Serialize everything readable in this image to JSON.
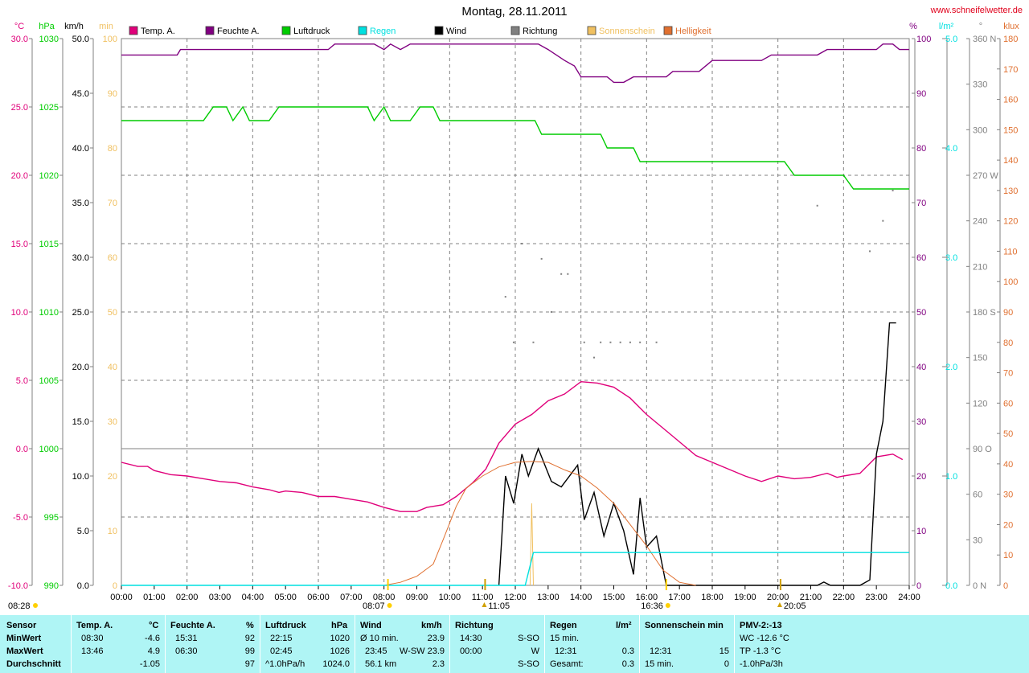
{
  "page": {
    "title": "Montag, 28.11.2011",
    "site": "www.schneifelwetter.de"
  },
  "colors": {
    "temp": "#e0007a",
    "humidity": "#800080",
    "pressure": "#00cc00",
    "rain": "#00e0e0",
    "wind": "#000000",
    "direction": "#808080",
    "sunshine": "#f0c060",
    "brightness": "#e07030",
    "table_bg": "#aff5f5"
  },
  "units": {
    "temp": "°C",
    "pressure": "hPa",
    "wind": "km/h",
    "sun": "min",
    "humidity": "%",
    "rain": "l/m²",
    "dir": "°",
    "lux": "klux"
  },
  "legend": [
    {
      "label": "Temp. A.",
      "color": "#e0007a"
    },
    {
      "label": "Feuchte A.",
      "color": "#800080"
    },
    {
      "label": "Luftdruck",
      "color": "#00cc00"
    },
    {
      "label": "Regen",
      "color": "#00e0e0"
    },
    {
      "label": "Wind",
      "color": "#000000"
    },
    {
      "label": "Richtung",
      "color": "#808080"
    },
    {
      "label": "Sonnenschein",
      "color": "#f0c060"
    },
    {
      "label": "Helligkeit",
      "color": "#e07030"
    }
  ],
  "chart_data": {
    "type": "line",
    "title": "Montag, 28.11.2011",
    "x_ticks": [
      "00:00",
      "01:00",
      "02:00",
      "03:00",
      "04:00",
      "05:00",
      "06:00",
      "07:00",
      "08:00",
      "09:00",
      "10:00",
      "11:00",
      "12:00",
      "13:00",
      "14:00",
      "15:00",
      "16:00",
      "17:00",
      "18:00",
      "19:00",
      "20:00",
      "21:00",
      "22:00",
      "23:00",
      "24:00"
    ],
    "axes": {
      "temp": {
        "ticks": [
          "30.0",
          "25.0",
          "20.0",
          "15.0",
          "10.0",
          "5.0",
          "0.0",
          "-5.0",
          "-10.0"
        ],
        "range": [
          -10,
          30
        ]
      },
      "pressure": {
        "ticks": [
          "1030",
          "1025",
          "1020",
          "1015",
          "1010",
          "1005",
          "1000",
          "995",
          "990"
        ],
        "range": [
          990,
          1030
        ]
      },
      "wind": {
        "ticks": [
          "50.0",
          "45.0",
          "40.0",
          "35.0",
          "30.0",
          "25.0",
          "20.0",
          "15.0",
          "10.0",
          "5.0",
          "0.0"
        ],
        "range": [
          0,
          50
        ]
      },
      "sun": {
        "ticks": [
          "100",
          "90",
          "80",
          "70",
          "60",
          "50",
          "40",
          "30",
          "20",
          "10",
          "0"
        ],
        "range": [
          0,
          100
        ]
      },
      "humidity": {
        "ticks": [
          "100",
          "90",
          "80",
          "70",
          "60",
          "50",
          "40",
          "30",
          "20",
          "10",
          "0"
        ],
        "range": [
          0,
          100
        ]
      },
      "rain": {
        "ticks": [
          "5.0",
          "4.0",
          "3.0",
          "2.0",
          "1.0",
          "0.0"
        ],
        "range": [
          0,
          5
        ]
      },
      "direction": {
        "ticks": [
          "360 N",
          "330",
          "300",
          "270 W",
          "240",
          "210",
          "180 S",
          "150",
          "120",
          "90 O",
          "60",
          "30",
          "0 N"
        ],
        "range": [
          0,
          360
        ]
      },
      "lux": {
        "ticks": [
          "180",
          "170",
          "160",
          "150",
          "140",
          "130",
          "120",
          "110",
          "100",
          "90",
          "80",
          "70",
          "60",
          "50",
          "40",
          "30",
          "20",
          "10",
          "0"
        ],
        "range": [
          0,
          180
        ]
      }
    },
    "events": [
      {
        "label": "08:28",
        "hour": 8.47,
        "kind": "temp-min"
      },
      {
        "label": "08:07",
        "hour": 8.12,
        "kind": "sunrise"
      },
      {
        "label": "11:05",
        "hour": 11.08,
        "kind": "moonrise"
      },
      {
        "label": "16:36",
        "hour": 16.6,
        "kind": "sunset"
      },
      {
        "label": "20:05",
        "hour": 20.08,
        "kind": "moonset"
      }
    ],
    "series": [
      {
        "name": "Temp. A.",
        "axis": "temp",
        "points": [
          [
            0,
            -1.0
          ],
          [
            0.5,
            -1.3
          ],
          [
            0.8,
            -1.3
          ],
          [
            1,
            -1.6
          ],
          [
            1.5,
            -1.9
          ],
          [
            2,
            -2.0
          ],
          [
            2.5,
            -2.2
          ],
          [
            3,
            -2.4
          ],
          [
            3.5,
            -2.5
          ],
          [
            4,
            -2.8
          ],
          [
            4.5,
            -3.0
          ],
          [
            4.8,
            -3.2
          ],
          [
            5,
            -3.1
          ],
          [
            5.5,
            -3.2
          ],
          [
            6,
            -3.5
          ],
          [
            6.5,
            -3.5
          ],
          [
            7,
            -3.7
          ],
          [
            7.5,
            -3.9
          ],
          [
            8,
            -4.3
          ],
          [
            8.5,
            -4.6
          ],
          [
            9,
            -4.6
          ],
          [
            9.3,
            -4.3
          ],
          [
            9.8,
            -4.1
          ],
          [
            10.2,
            -3.5
          ],
          [
            10.7,
            -2.5
          ],
          [
            11.1,
            -1.5
          ],
          [
            11.5,
            0.4
          ],
          [
            12,
            1.8
          ],
          [
            12.5,
            2.5
          ],
          [
            12.8,
            3.1
          ],
          [
            13,
            3.5
          ],
          [
            13.5,
            4.0
          ],
          [
            14,
            4.9
          ],
          [
            14.5,
            4.8
          ],
          [
            15,
            4.5
          ],
          [
            15.5,
            3.7
          ],
          [
            16,
            2.5
          ],
          [
            16.5,
            1.5
          ],
          [
            17,
            0.5
          ],
          [
            17.5,
            -0.5
          ],
          [
            18,
            -1.0
          ],
          [
            18.5,
            -1.5
          ],
          [
            19,
            -2.0
          ],
          [
            19.5,
            -2.4
          ],
          [
            20,
            -2.0
          ],
          [
            20.5,
            -2.2
          ],
          [
            21,
            -2.1
          ],
          [
            21.5,
            -1.8
          ],
          [
            21.8,
            -2.1
          ],
          [
            22,
            -2.0
          ],
          [
            22.5,
            -1.8
          ],
          [
            23,
            -0.6
          ],
          [
            23.5,
            -0.4
          ],
          [
            23.8,
            -0.8
          ]
        ]
      },
      {
        "name": "Feuchte A.",
        "axis": "humidity",
        "points": [
          [
            0,
            97
          ],
          [
            1.7,
            97
          ],
          [
            1.8,
            98
          ],
          [
            6.3,
            98
          ],
          [
            6.5,
            99
          ],
          [
            7.7,
            99
          ],
          [
            8,
            98
          ],
          [
            8.2,
            99
          ],
          [
            8.5,
            98
          ],
          [
            8.8,
            99
          ],
          [
            12.7,
            99
          ],
          [
            13,
            98
          ],
          [
            13.5,
            96
          ],
          [
            13.8,
            95
          ],
          [
            14,
            93
          ],
          [
            14.8,
            93
          ],
          [
            15,
            92
          ],
          [
            15.3,
            92
          ],
          [
            15.6,
            93
          ],
          [
            16.6,
            93
          ],
          [
            16.8,
            94
          ],
          [
            17.6,
            94
          ],
          [
            18,
            96
          ],
          [
            19.5,
            96
          ],
          [
            19.8,
            97
          ],
          [
            21.2,
            97
          ],
          [
            21.5,
            98
          ],
          [
            23,
            98
          ],
          [
            23.2,
            99
          ],
          [
            23.5,
            99
          ],
          [
            23.7,
            98
          ],
          [
            24,
            98
          ]
        ]
      },
      {
        "name": "Luftdruck",
        "axis": "pressure",
        "points": [
          [
            0,
            1024
          ],
          [
            2.5,
            1024
          ],
          [
            2.8,
            1025
          ],
          [
            3.2,
            1025
          ],
          [
            3.4,
            1024
          ],
          [
            3.7,
            1025
          ],
          [
            3.9,
            1024
          ],
          [
            4.5,
            1024
          ],
          [
            4.8,
            1025
          ],
          [
            7.5,
            1025
          ],
          [
            7.7,
            1024
          ],
          [
            8.0,
            1025
          ],
          [
            8.2,
            1024
          ],
          [
            8.8,
            1024
          ],
          [
            9.1,
            1025
          ],
          [
            9.5,
            1025
          ],
          [
            9.7,
            1024
          ],
          [
            12.6,
            1024
          ],
          [
            12.8,
            1023
          ],
          [
            14.6,
            1023
          ],
          [
            14.8,
            1022
          ],
          [
            15.6,
            1022
          ],
          [
            15.8,
            1021
          ],
          [
            20.2,
            1021
          ],
          [
            20.5,
            1020
          ],
          [
            22,
            1020
          ],
          [
            22.3,
            1019
          ],
          [
            24,
            1019
          ]
        ]
      },
      {
        "name": "Wind",
        "axis": "wind",
        "points": [
          [
            11.5,
            0
          ],
          [
            11.7,
            10
          ],
          [
            11.95,
            7.5
          ],
          [
            12.2,
            12
          ],
          [
            12.4,
            10
          ],
          [
            12.7,
            12.5
          ],
          [
            13.1,
            9.5
          ],
          [
            13.4,
            9
          ],
          [
            13.9,
            11
          ],
          [
            14.1,
            6
          ],
          [
            14.4,
            8.5
          ],
          [
            14.7,
            4.5
          ],
          [
            15.0,
            7.5
          ],
          [
            15.3,
            5
          ],
          [
            15.6,
            1
          ],
          [
            15.8,
            8
          ],
          [
            16.0,
            3.5
          ],
          [
            16.3,
            4.5
          ],
          [
            16.6,
            0
          ],
          [
            21.2,
            0
          ],
          [
            21.4,
            0.3
          ],
          [
            21.6,
            0
          ],
          [
            22.5,
            0
          ],
          [
            22.8,
            0.5
          ],
          [
            23.0,
            12
          ],
          [
            23.2,
            15
          ],
          [
            23.4,
            24
          ],
          [
            23.6,
            24
          ]
        ]
      },
      {
        "name": "Sonnenschein",
        "axis": "sun",
        "points": [
          [
            12.45,
            0
          ],
          [
            12.5,
            15
          ],
          [
            12.55,
            0
          ]
        ]
      },
      {
        "name": "Helligkeit",
        "axis": "lux",
        "points": [
          [
            8.0,
            0
          ],
          [
            8.5,
            1
          ],
          [
            9.0,
            3
          ],
          [
            9.5,
            7
          ],
          [
            9.8,
            15
          ],
          [
            10.2,
            26
          ],
          [
            10.5,
            32
          ],
          [
            11,
            36
          ],
          [
            11.5,
            39
          ],
          [
            12,
            40.5
          ],
          [
            12.5,
            40.8
          ],
          [
            13,
            40.5
          ],
          [
            13.5,
            38
          ],
          [
            14,
            36
          ],
          [
            14.5,
            32
          ],
          [
            15,
            27
          ],
          [
            15.5,
            20
          ],
          [
            16,
            13
          ],
          [
            16.5,
            5
          ],
          [
            17,
            1
          ],
          [
            17.5,
            0
          ]
        ]
      },
      {
        "name": "Regen",
        "axis": "rain",
        "points": [
          [
            0,
            0
          ],
          [
            12.3,
            0
          ],
          [
            12.55,
            0.3
          ],
          [
            12.6,
            0.3
          ],
          [
            24,
            0.3
          ]
        ]
      },
      {
        "name": "Richtung",
        "axis": "direction",
        "points": [
          [
            11.7,
            190
          ],
          [
            11.95,
            160
          ],
          [
            12.2,
            225
          ],
          [
            12.55,
            160
          ],
          [
            12.8,
            215
          ],
          [
            13.1,
            180
          ],
          [
            13.4,
            205
          ],
          [
            13.6,
            205
          ],
          [
            14.1,
            160
          ],
          [
            14.4,
            150
          ],
          [
            14.6,
            160
          ],
          [
            14.9,
            160
          ],
          [
            15.2,
            160
          ],
          [
            15.5,
            160
          ],
          [
            15.8,
            160
          ],
          [
            16.3,
            160
          ],
          [
            21.2,
            250
          ],
          [
            22.8,
            220
          ],
          [
            23.2,
            240
          ],
          [
            23.5,
            260
          ]
        ]
      }
    ]
  },
  "table": {
    "row_labels": [
      "Sensor",
      "MinWert",
      "MaxWert",
      "Durchschnitt"
    ],
    "temp": {
      "head": "Temp. A.",
      "unit": "°C",
      "min_time": "08:30",
      "min_val": "-4.6",
      "max_time": "13:46",
      "max_val": "4.9",
      "avg": "-1.05"
    },
    "humidity": {
      "head": "Feuchte A.",
      "unit": "%",
      "min_time": "15:31",
      "min_val": "92",
      "max_time": "06:30",
      "max_val": "99",
      "avg": "97"
    },
    "pressure": {
      "head": "Luftdruck",
      "unit": "hPa",
      "min_time": "22:15",
      "min_val": "1020",
      "max_time": "02:45",
      "max_val": "1026",
      "avg_label": "^1.0hPa/h",
      "avg": "1024.0"
    },
    "wind": {
      "head": "Wind",
      "unit": "km/h",
      "r1_label": "Ø 10 min.",
      "r1_val": "23.9",
      "r2_time": "23:45",
      "r2_val": "W-SW 23.9",
      "r3_label": "56.1 km",
      "r3_val": "2.3"
    },
    "direction": {
      "head": "Richtung",
      "r1_time": "14:30",
      "r1_val": "S-SO",
      "r2_time": "00:00",
      "r2_val": "W",
      "r3_val": "S-SO"
    },
    "rain": {
      "head": "Regen",
      "unit": "l/m²",
      "r1_label": "15 min.",
      "r2_time": "12:31",
      "r2_val": "0.3",
      "r3_label": "Gesamt:",
      "r3_val": "0.3"
    },
    "sun": {
      "head": "Sonnenschein min",
      "r2_time": "12:31",
      "r2_val": "15",
      "r3_label": "15 min.",
      "r3_val": "0"
    },
    "pmv": {
      "head": "PMV-2:-13",
      "r1": "WC -12.6 °C",
      "r2": "TP -1.3 °C",
      "r3": "-1.0hPa/3h"
    }
  }
}
